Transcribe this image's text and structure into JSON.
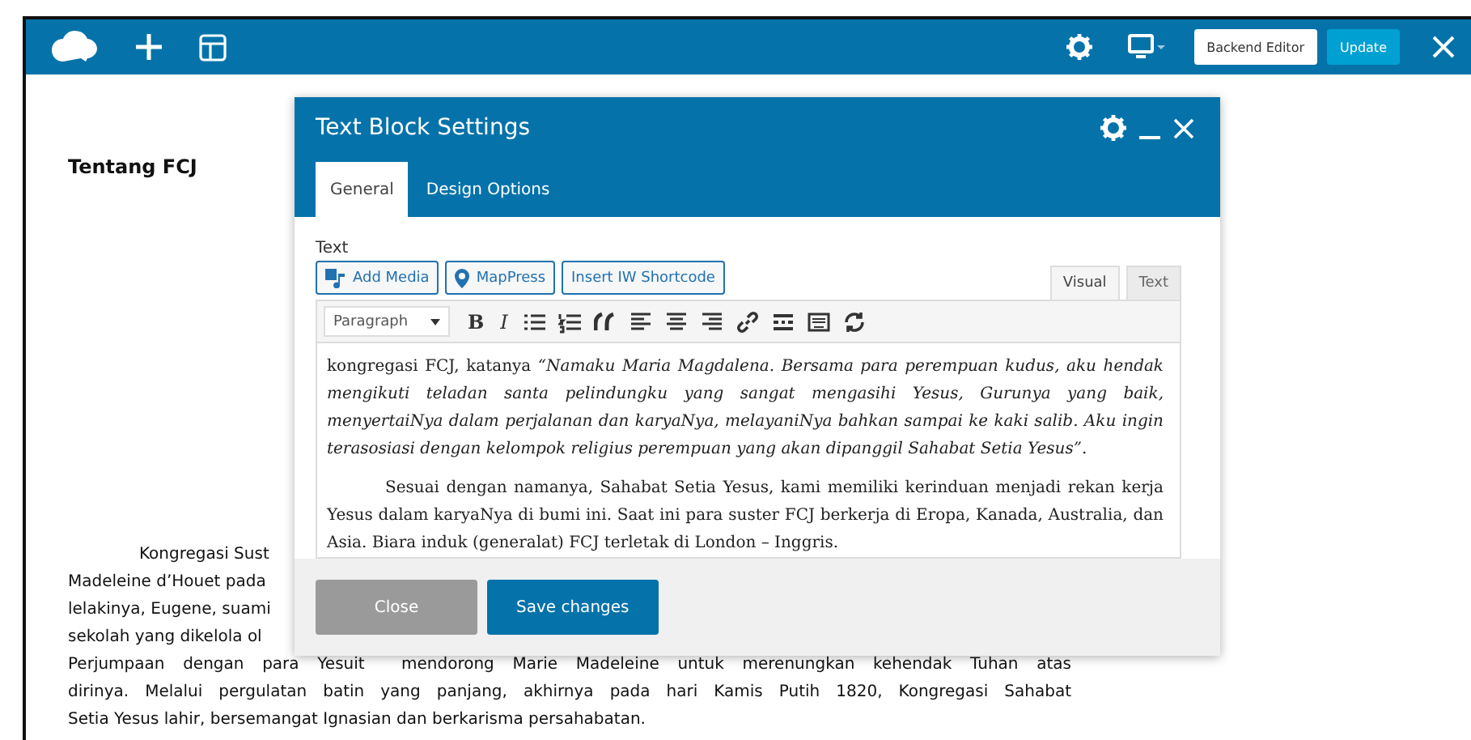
{
  "topbar": {
    "left_tools": [
      {
        "kind": "logo"
      },
      {
        "kind": "add"
      },
      {
        "kind": "layout"
      }
    ],
    "right_tools": [
      {
        "kind": "settings"
      },
      {
        "kind": "device"
      }
    ],
    "buttons": [
      {
        "label": "Backend Editor",
        "kind": "secondary"
      },
      {
        "label": "Update",
        "kind": "primary"
      }
    ]
  },
  "page": {
    "heading": "Tentang FCJ",
    "lines": [
      {
        "text": "Kongregasi Sust",
        "kind": "first"
      },
      {
        "text": "Madeleine d’Houet pada",
        "kind": "partial"
      },
      {
        "text": "lelakinya, Eugene, suami",
        "kind": "partial"
      },
      {
        "text": "sekolah yang dikelola ol",
        "kind": "partial"
      },
      {
        "text": "Perjumpaan dengan para Yesuit  mendorong Marie Madeleine untuk merenungkan kehendak Tuhan atas",
        "kind": "full"
      },
      {
        "text": "dirinya. Melalui pergulatan batin yang panjang, akhirnya pada hari Kamis Putih 1820, Kongregasi Sahabat",
        "kind": "full"
      },
      {
        "text": "Setia Yesus lahir, bersemangat Ignasian dan berkarisma persahabatan.",
        "kind": "last"
      }
    ]
  },
  "modal": {
    "title": "Text Block Settings",
    "tabs": [
      {
        "label": "General",
        "selected": true
      },
      {
        "label": "Design Options",
        "selected": false
      }
    ],
    "field_label": "Text",
    "media_buttons": [
      {
        "label": "Add Media",
        "kind": "media"
      },
      {
        "label": "MapPress",
        "kind": "location"
      },
      {
        "label": "Insert IW Shortcode",
        "kind": "plain"
      }
    ],
    "editor_tabs": [
      {
        "label": "Visual",
        "selected": true
      },
      {
        "label": "Text",
        "selected": false
      }
    ],
    "format_select": "Paragraph",
    "toolbar": [
      {
        "kind": "bold",
        "label": "B"
      },
      {
        "kind": "italic",
        "label": "I"
      },
      {
        "kind": "bullets"
      },
      {
        "kind": "numbers"
      },
      {
        "kind": "quote"
      },
      {
        "kind": "align-left"
      },
      {
        "kind": "align-center"
      },
      {
        "kind": "align-right"
      },
      {
        "kind": "link"
      },
      {
        "kind": "more"
      },
      {
        "kind": "keyboard"
      },
      {
        "kind": "refresh"
      }
    ],
    "paragraphs": [
      {
        "text": "kongregasi FCJ,  katanya *“Namaku Maria Magdalena. Bersama para perempuan kudus, aku hendak mengikuti teladan santa pelindungku yang sangat mengasihi Yesus, Gurunya yang baik, menyertaiNya dalam perjalanan dan karyaNya, melayaniNya bahkan sampai ke kaki salib.  Aku ingin terasosiasi dengan kelompok religius perempuan yang akan dipanggil Sahabat Setia Yesus”*.",
        "indent": false
      },
      {
        "text": "Sesuai dengan namanya, Sahabat Setia Yesus, kami memiliki kerinduan menjadi rekan kerja Yesus dalam karyaNya di bumi ini.  Saat ini para suster FCJ berkerja di Eropa, Kanada, Australia, dan Asia.  Biara induk (generalat) FCJ terletak di London – Inggris.",
        "indent": true
      }
    ],
    "footer_buttons": [
      {
        "label": "Close",
        "disabled": true
      },
      {
        "label": "Save changes",
        "disabled": false
      }
    ]
  }
}
